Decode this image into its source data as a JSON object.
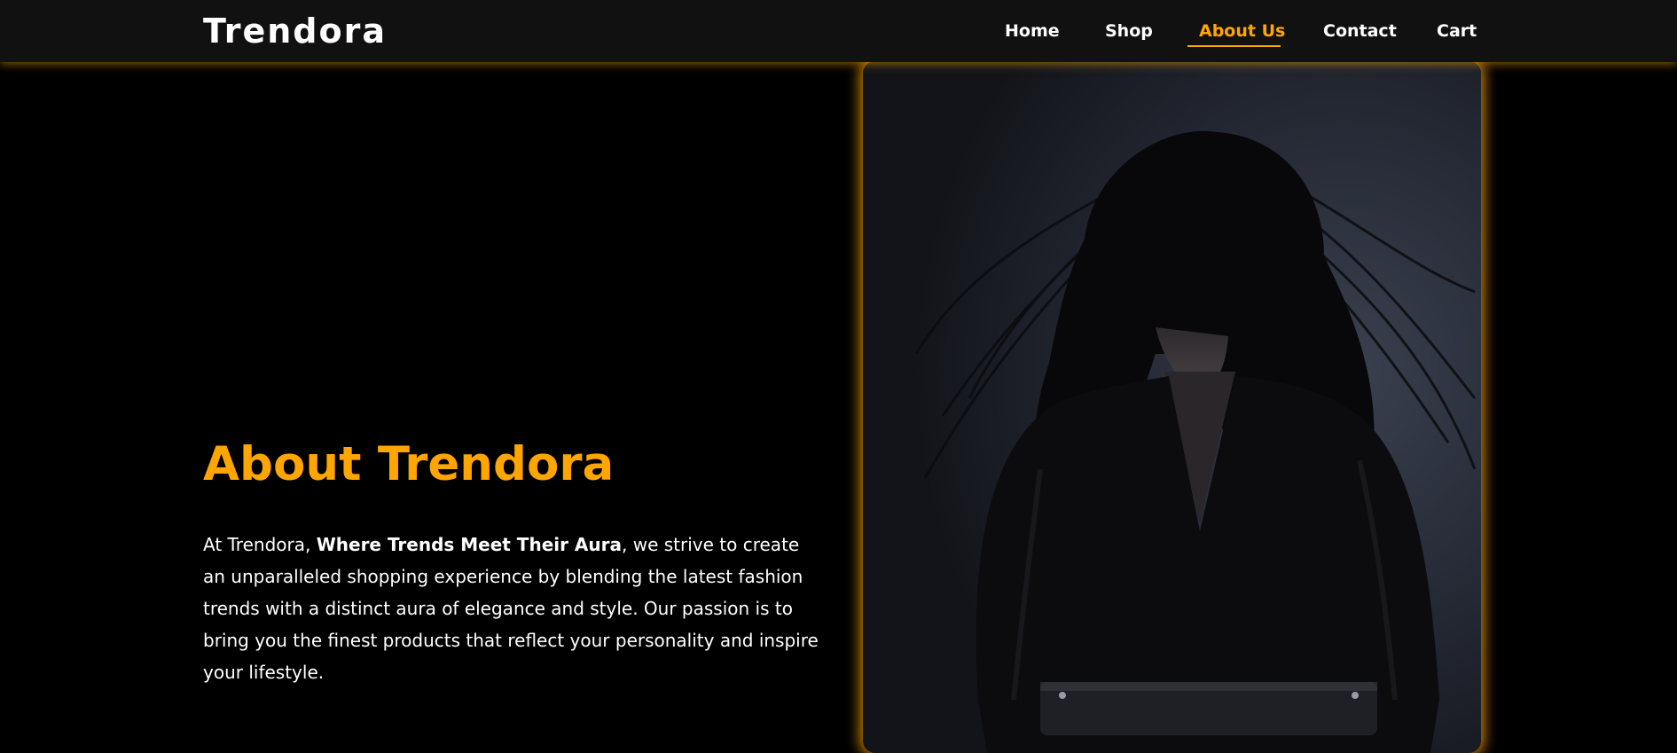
{
  "brand": {
    "name": "Trendora"
  },
  "nav": {
    "home": "Home",
    "shop": "Shop",
    "about": "About Us",
    "contact": "Contact",
    "cart": "Cart",
    "active_item": "About Us"
  },
  "about": {
    "title": "About Trendora",
    "para_prefix": "At Trendora, ",
    "para_bold": "Where Trends Meet Their Aura",
    "para_suffix": ", we strive to create an unparalleled shopping experience by blending the latest fashion trends with a distinct aura of elegance and style. Our passion is to bring you the finest products that reflect your personality and inspire your lifestyle."
  },
  "colors": {
    "accent": "#ffa500",
    "navbar_bg": "#111111",
    "page_bg": "#000000"
  },
  "image": {
    "subject": "woman with long black hair in black dress"
  }
}
